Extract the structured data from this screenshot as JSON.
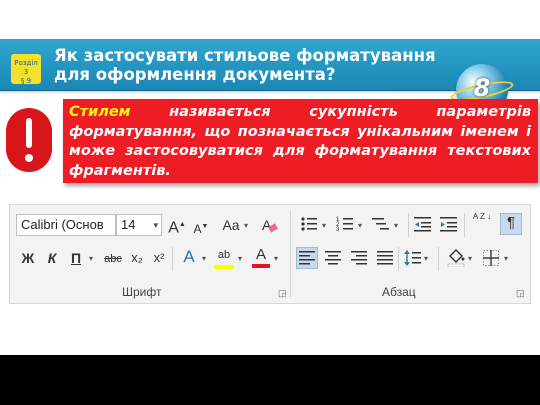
{
  "slide": {
    "section_badge": {
      "line1": "Розділ 3",
      "line2": "§ 9"
    },
    "title": "Як застосувати стильове форматування для оформлення документа?",
    "grade_number": "8",
    "definition": {
      "term": "Стилем",
      "rest": " називається сукупність параметрів форматування, що позначається унікальним іменем і може застосовуватися для форматування текстових фрагментів."
    }
  },
  "ribbon": {
    "font_group": {
      "font_name": "Calibri (Основ",
      "font_size": "14",
      "grow_font": "A",
      "shrink_font": "A",
      "change_case": "Aa",
      "bold": "Ж",
      "italic": "К",
      "underline": "П",
      "strikethrough": "abc",
      "subscript": "x₂",
      "superscript": "x²",
      "text_effects": "A",
      "highlight": "ab",
      "font_color": "A",
      "label": "Шрифт"
    },
    "paragraph_group": {
      "sort": "A Z",
      "show_marks": "¶",
      "label": "Абзац"
    },
    "colors": {
      "font_color_underline": "#e81123",
      "highlight_underline": "#ffff00",
      "text_effects": "#2e75b6"
    }
  }
}
